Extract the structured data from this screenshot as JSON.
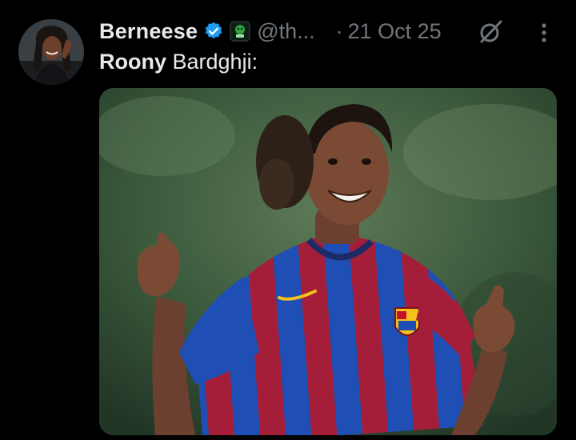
{
  "tweet": {
    "author": {
      "display_name": "Berneese",
      "handle": "@th...",
      "verified": true,
      "avatar_icon": "profile-photo"
    },
    "separator": "·",
    "timestamp": "21 Oct 25",
    "text": {
      "bold_part": "Roony",
      "rest": " Bardghji:"
    },
    "media_icon": "photo-footballer-smiling-in-striped-kit"
  },
  "colors": {
    "background": "#000000",
    "text_primary": "#e7e9ea",
    "text_secondary": "#71767b",
    "verified": "#1d9bf0",
    "kit_blue": "#1f4fb5",
    "kit_red": "#b0203a"
  }
}
